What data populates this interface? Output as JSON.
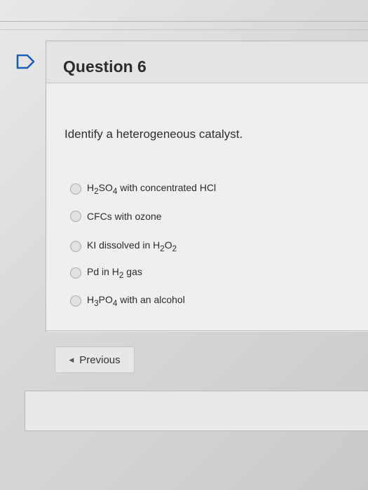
{
  "question": {
    "title": "Question 6",
    "prompt": "Identify a heterogeneous catalyst."
  },
  "options": [
    {
      "parts": [
        [
          "H",
          ""
        ],
        [
          "2",
          "sub"
        ],
        [
          "SO",
          ""
        ],
        [
          "4",
          "sub"
        ],
        [
          " with concentrated HCl",
          ""
        ]
      ]
    },
    {
      "parts": [
        [
          "CFCs with ozone",
          ""
        ]
      ]
    },
    {
      "parts": [
        [
          "KI dissolved in H",
          ""
        ],
        [
          "2",
          "sub"
        ],
        [
          "O",
          ""
        ],
        [
          "2",
          "sub"
        ]
      ]
    },
    {
      "parts": [
        [
          "Pd in H",
          ""
        ],
        [
          "2",
          "sub"
        ],
        [
          " gas",
          ""
        ]
      ]
    },
    {
      "parts": [
        [
          "H",
          ""
        ],
        [
          "3",
          "sub"
        ],
        [
          "PO",
          ""
        ],
        [
          "4",
          "sub"
        ],
        [
          " with an alcohol",
          ""
        ]
      ]
    }
  ],
  "navigation": {
    "previous_label": "Previous"
  },
  "icons": {
    "flag": "flag-icon",
    "previous": "caret-left-icon"
  },
  "colors": {
    "accent": "#1a5fb4"
  }
}
